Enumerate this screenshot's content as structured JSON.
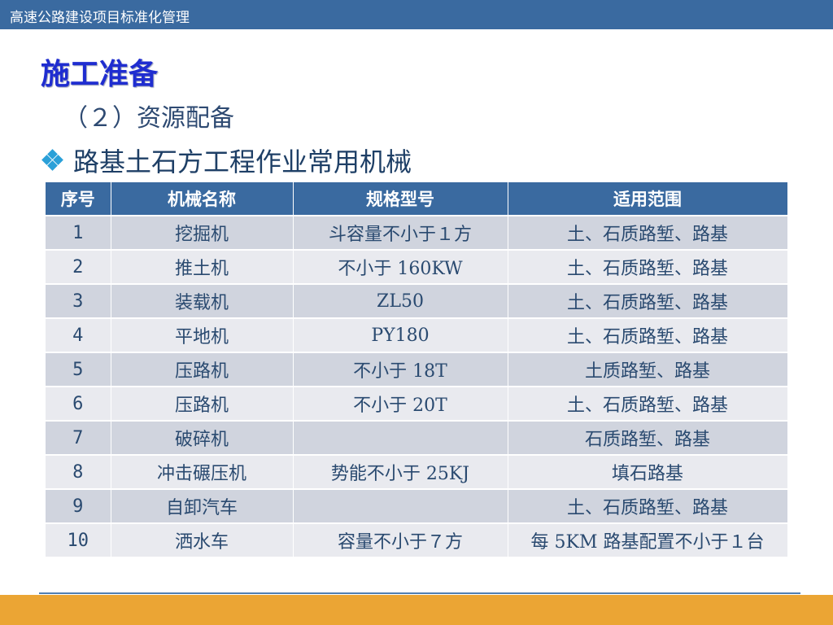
{
  "header": {
    "title": "高速公路建设项目标准化管理"
  },
  "page": {
    "title": "施工准备",
    "subtitle": "（２）资源配备",
    "bullet": "路基土石方工程作业常用机械"
  },
  "table": {
    "headers": [
      "序号",
      "机械名称",
      "规格型号",
      "适用范围"
    ],
    "rows": [
      [
        "1",
        "挖掘机",
        "斗容量不小于１方",
        "土、石质路堑、路基"
      ],
      [
        "2",
        "推土机",
        "不小于 160KW",
        "土、石质路堑、路基"
      ],
      [
        "3",
        "装载机",
        "ZL50",
        "土、石质路堑、路基"
      ],
      [
        "4",
        "平地机",
        "PY180",
        "土、石质路堑、路基"
      ],
      [
        "5",
        "压路机",
        "不小于 18T",
        "土质路堑、路基"
      ],
      [
        "6",
        "压路机",
        "不小于 20T",
        "土、石质路堑、路基"
      ],
      [
        "7",
        "破碎机",
        "",
        "石质路堑、路基"
      ],
      [
        "8",
        "冲击碾压机",
        "势能不小于 25KJ",
        "填石路基"
      ],
      [
        "9",
        "自卸汽车",
        "",
        "土、石质路堑、路基"
      ],
      [
        "10",
        "洒水车",
        "容量不小于７方",
        "每 5KM 路基配置不小于１台"
      ]
    ]
  },
  "colors": {
    "header_bar": "#3a6aa0",
    "title": "#1f2dd0",
    "row_odd": "#d0d4de",
    "row_even": "#e9eaef",
    "bottom_bar": "#eba534"
  },
  "icons": {
    "bullet": "diamond-bullet-icon"
  }
}
